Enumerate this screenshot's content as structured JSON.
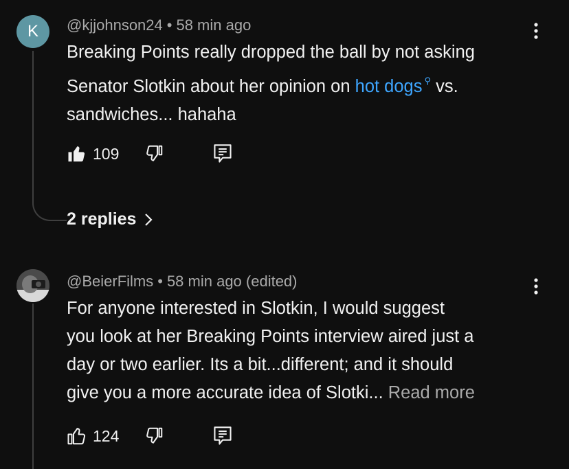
{
  "comments": [
    {
      "avatar_letter": "K",
      "author": "@kjjohnson24",
      "time": "58 min ago",
      "text_before": "Breaking Points really dropped the ball by not asking Senator Slotkin about her opinion on ",
      "link_text": "hot dogs",
      "text_after": " vs. sandwiches... hahaha",
      "like_count": "109",
      "replies_label": "2 replies"
    },
    {
      "author": "@BeierFilms",
      "time": "58 min ago (edited)",
      "text_line1": "For anyone interested in Slotkin, I would suggest",
      "text_line2": "you look at her Breaking Points interview aired just a",
      "text_line3": "day or two earlier.  Its a bit...different; and it should",
      "text_line4": "give you a more accurate idea of Slotki... ",
      "read_more": "Read more",
      "like_count": "124"
    }
  ],
  "colors": {
    "background": "#0f0f0f",
    "link": "#3ea6ff",
    "secondary_text": "#aaaaaa",
    "avatar_teal": "#5e97a3"
  },
  "icons": [
    "thumbs-up-icon",
    "thumbs-down-icon",
    "reply-icon",
    "more-vert-icon",
    "chevron-right-icon",
    "search-icon"
  ]
}
